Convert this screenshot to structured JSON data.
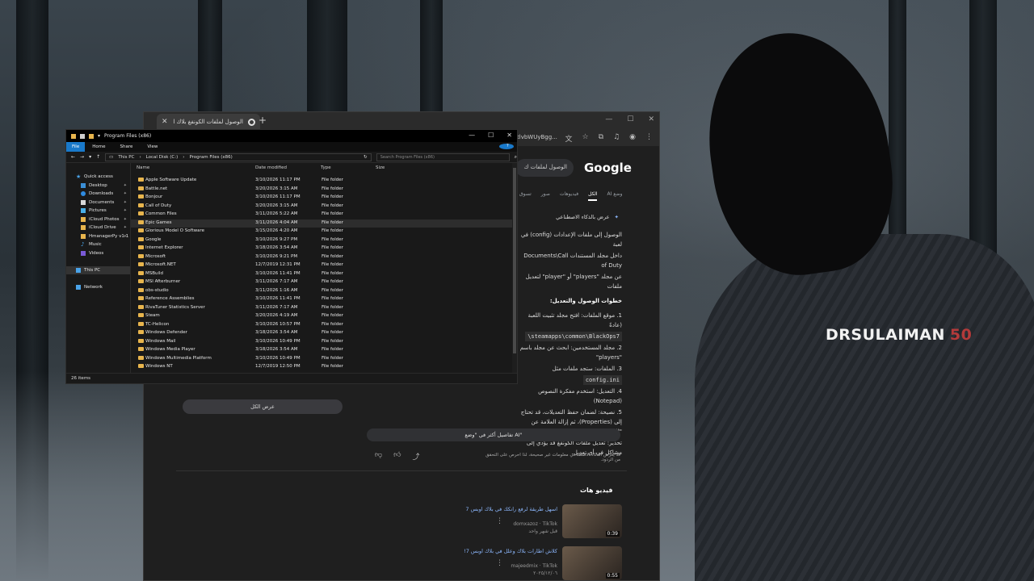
{
  "wallpaper": {
    "watermark_name": "DRSULAIMAN",
    "watermark_number": "50"
  },
  "chrome": {
    "tab_title": "الوصول لملفات الكونفغ بلاك اوب...",
    "url_fragment": "tlvbWUyBgg...",
    "google": {
      "logo": "Google",
      "search_text": "الوصول لملفات ك",
      "tabs": [
        "وضع AI",
        "الكل",
        "فيديوهات",
        "صور",
        "تسوق"
      ],
      "active_tab": "الكل",
      "ai_overview_label": "عرض بالذكاء الاصطناعي",
      "ai_paragraphs": [
        "الوصول إلى ملفات الإعدادات (config) في لعبة",
        "داخل مجلد المستندات Documents\\Call of Duty",
        "عن مجلد \"players\" أو \"player\" لتعديل ملفات"
      ],
      "steps_heading": "خطوات الوصول والتعديل:",
      "steps": [
        "1. موقع الملفات: افتح مجلد تثبيت اللعبة (عادةً",
        "2. مجلد المستخدمين: ابحث عن مجلد باسم \"players\"",
        "3. الملفات: ستجد ملفات مثل",
        "4. التعديل: استخدم مفكرة النصوص (Notepad)",
        "5. نصيحة: لضمان حفظ التعديلات، قد تحتاج إلى (Properties)، ثم إزالة العلامة عن \"للقراءة",
        "تحذير: تعديل ملفات الكونفغ قد يؤدي إلى مشاكل في أي تعديل."
      ],
      "code_path": "\\steamapps\\common\\BlackOps7",
      "code_file": "config.ini",
      "show_all": "عرض الكل",
      "more_ai": "تفاصيل أكثر في \"وضع AI\"",
      "disclaimer": "قد يعرض الذكاء الاصطناعي معلومات غير صحيحة، لذا احرص على التحقق من الردود.",
      "videos_heading": "فيديو هات",
      "videos": [
        {
          "title": "اسهل طريقة لرفع رانكك في بلاك اوبس 7",
          "channel": "domxazoz · TikTok",
          "age": "قبل شهر واحد",
          "duration": "0:39"
        },
        {
          "title": "كلاش اطارات بلاك وعلل في بلاك اوبس 7!",
          "channel": "majeedmix · TikTok",
          "age": "٢٠٢٥/١٢/٠٦",
          "duration": "0:55"
        }
      ]
    }
  },
  "explorer": {
    "title": "Program Files (x86)",
    "ribbon": [
      "File",
      "Home",
      "Share",
      "View"
    ],
    "breadcrumb": [
      "This PC",
      "Local Disk (C:)",
      "Program Files (x86)"
    ],
    "search_placeholder": "Search Program Files (x86)",
    "columns": {
      "name": "Name",
      "date": "Date modified",
      "type": "Type",
      "size": "Size"
    },
    "sidebar": [
      {
        "label": "Quick access",
        "top": true
      },
      {
        "label": "Desktop",
        "pin": true
      },
      {
        "label": "Downloads",
        "pin": true
      },
      {
        "label": "Documents",
        "pin": true
      },
      {
        "label": "Pictures",
        "pin": true
      },
      {
        "label": "iCloud Photos",
        "pin": true
      },
      {
        "label": "iCloud Drive",
        "pin": true
      },
      {
        "label": "HmanagerPy v1.1",
        "pin": true
      },
      {
        "label": "Music"
      },
      {
        "label": "Videos"
      },
      {
        "label": ""
      },
      {
        "label": "This PC",
        "top": true,
        "selected": true
      },
      {
        "label": ""
      },
      {
        "label": "Network",
        "top": true
      }
    ],
    "files": [
      {
        "name": "Apple Software Update",
        "date": "3/10/2026 11:17 PM",
        "type": "File folder"
      },
      {
        "name": "Battle.net",
        "date": "3/20/2026 3:15 AM",
        "type": "File folder"
      },
      {
        "name": "Bonjour",
        "date": "3/10/2026 11:17 PM",
        "type": "File folder"
      },
      {
        "name": "Call of Duty",
        "date": "3/20/2026 3:15 AM",
        "type": "File folder"
      },
      {
        "name": "Common Files",
        "date": "3/11/2026 5:22 AM",
        "type": "File folder"
      },
      {
        "name": "Epic Games",
        "date": "3/11/2026 4:04 AM",
        "type": "File folder"
      },
      {
        "name": "Glorious Model O Software",
        "date": "3/15/2026 4:20 AM",
        "type": "File folder"
      },
      {
        "name": "Google",
        "date": "3/10/2026 9:27 PM",
        "type": "File folder"
      },
      {
        "name": "Internet Explorer",
        "date": "3/18/2026 3:54 AM",
        "type": "File folder"
      },
      {
        "name": "Microsoft",
        "date": "3/10/2026 9:21 PM",
        "type": "File folder"
      },
      {
        "name": "Microsoft.NET",
        "date": "12/7/2019 12:31 PM",
        "type": "File folder"
      },
      {
        "name": "MSBuild",
        "date": "3/10/2026 11:41 PM",
        "type": "File folder"
      },
      {
        "name": "MSI Afterburner",
        "date": "3/11/2026 7:17 AM",
        "type": "File folder"
      },
      {
        "name": "obs-studio",
        "date": "3/11/2026 1:16 AM",
        "type": "File folder"
      },
      {
        "name": "Reference Assemblies",
        "date": "3/10/2026 11:41 PM",
        "type": "File folder"
      },
      {
        "name": "RivaTuner Statistics Server",
        "date": "3/11/2026 7:17 AM",
        "type": "File folder"
      },
      {
        "name": "Steam",
        "date": "3/20/2026 4:19 AM",
        "type": "File folder"
      },
      {
        "name": "TC-Helicon",
        "date": "3/10/2026 10:57 PM",
        "type": "File folder"
      },
      {
        "name": "Windows Defender",
        "date": "3/18/2026 3:54 AM",
        "type": "File folder"
      },
      {
        "name": "Windows Mail",
        "date": "3/10/2026 10:49 PM",
        "type": "File folder"
      },
      {
        "name": "Windows Media Player",
        "date": "3/18/2026 3:54 AM",
        "type": "File folder"
      },
      {
        "name": "Windows Multimedia Platform",
        "date": "3/10/2026 10:49 PM",
        "type": "File folder"
      },
      {
        "name": "Windows NT",
        "date": "12/7/2019 12:50 PM",
        "type": "File folder"
      }
    ],
    "highlighted_row": "Epic Games",
    "status": "26 items"
  }
}
